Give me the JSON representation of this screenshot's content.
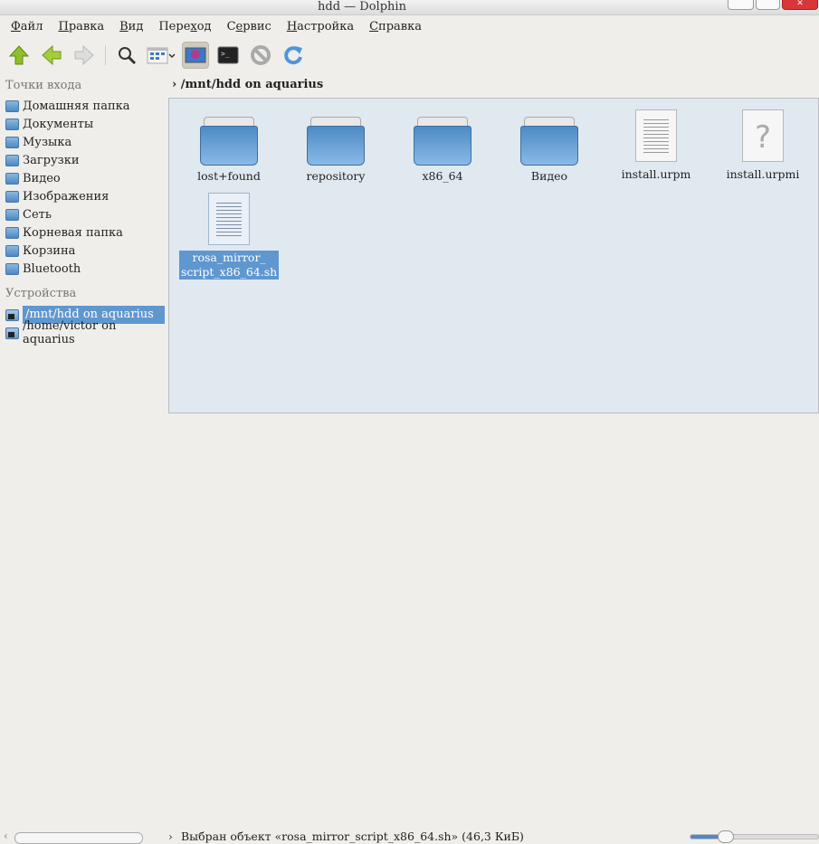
{
  "window": {
    "title": "hdd — Dolphin"
  },
  "menu": [
    {
      "u": "Ф",
      "rest": "айл"
    },
    {
      "u": "П",
      "rest": "равка"
    },
    {
      "u": "В",
      "rest": "ид"
    },
    {
      "pre": "Пере",
      "u": "х",
      "rest": "од"
    },
    {
      "pre": "С",
      "u": "е",
      "rest": "рвис"
    },
    {
      "u": "Н",
      "rest": "астройка"
    },
    {
      "u": "С",
      "rest": "правка"
    }
  ],
  "menu_labels": [
    "Файл",
    "Правка",
    "Вид",
    "Переход",
    "Сервис",
    "Настройка",
    "Справка"
  ],
  "toolbar": [
    "up-icon",
    "back-icon",
    "forward-icon",
    "search-icon",
    "view-mode-icon",
    "preview-icon",
    "terminal-icon",
    "stop-icon",
    "reload-icon"
  ],
  "sidebar": {
    "places_header": "Точки входа",
    "places": [
      "Домашняя папка",
      "Документы",
      "Музыка",
      "Загрузки",
      "Видео",
      "Изображения",
      "Сеть",
      "Корневая папка",
      "Корзина",
      "Bluetooth"
    ],
    "devices_header": "Устройства",
    "devices": [
      "/mnt/hdd on aquarius",
      "/home/victor on aquarius"
    ]
  },
  "breadcrumb": "/mnt/hdd on aquarius",
  "files": [
    {
      "name": "lost+found",
      "type": "folder"
    },
    {
      "name": "repository",
      "type": "folder"
    },
    {
      "name": "x86_64",
      "type": "folder"
    },
    {
      "name": "Видео",
      "type": "folder"
    },
    {
      "name": "install.urpm",
      "type": "text"
    },
    {
      "name": "install.urpmi",
      "type": "unknown"
    },
    {
      "name": "rosa_mirror_script_x86_64.sh",
      "line1": "rosa_mirror_",
      "line2": "script_x86_64.sh",
      "type": "script",
      "selected": true
    }
  ],
  "status": {
    "text": "Выбран объект «rosa_mirror_script_x86_64.sh» (46,3 КиБ)"
  },
  "colors": {
    "selection": "#5f97cf",
    "view_bg": "#e0e9f0",
    "close": "#d9363a"
  }
}
